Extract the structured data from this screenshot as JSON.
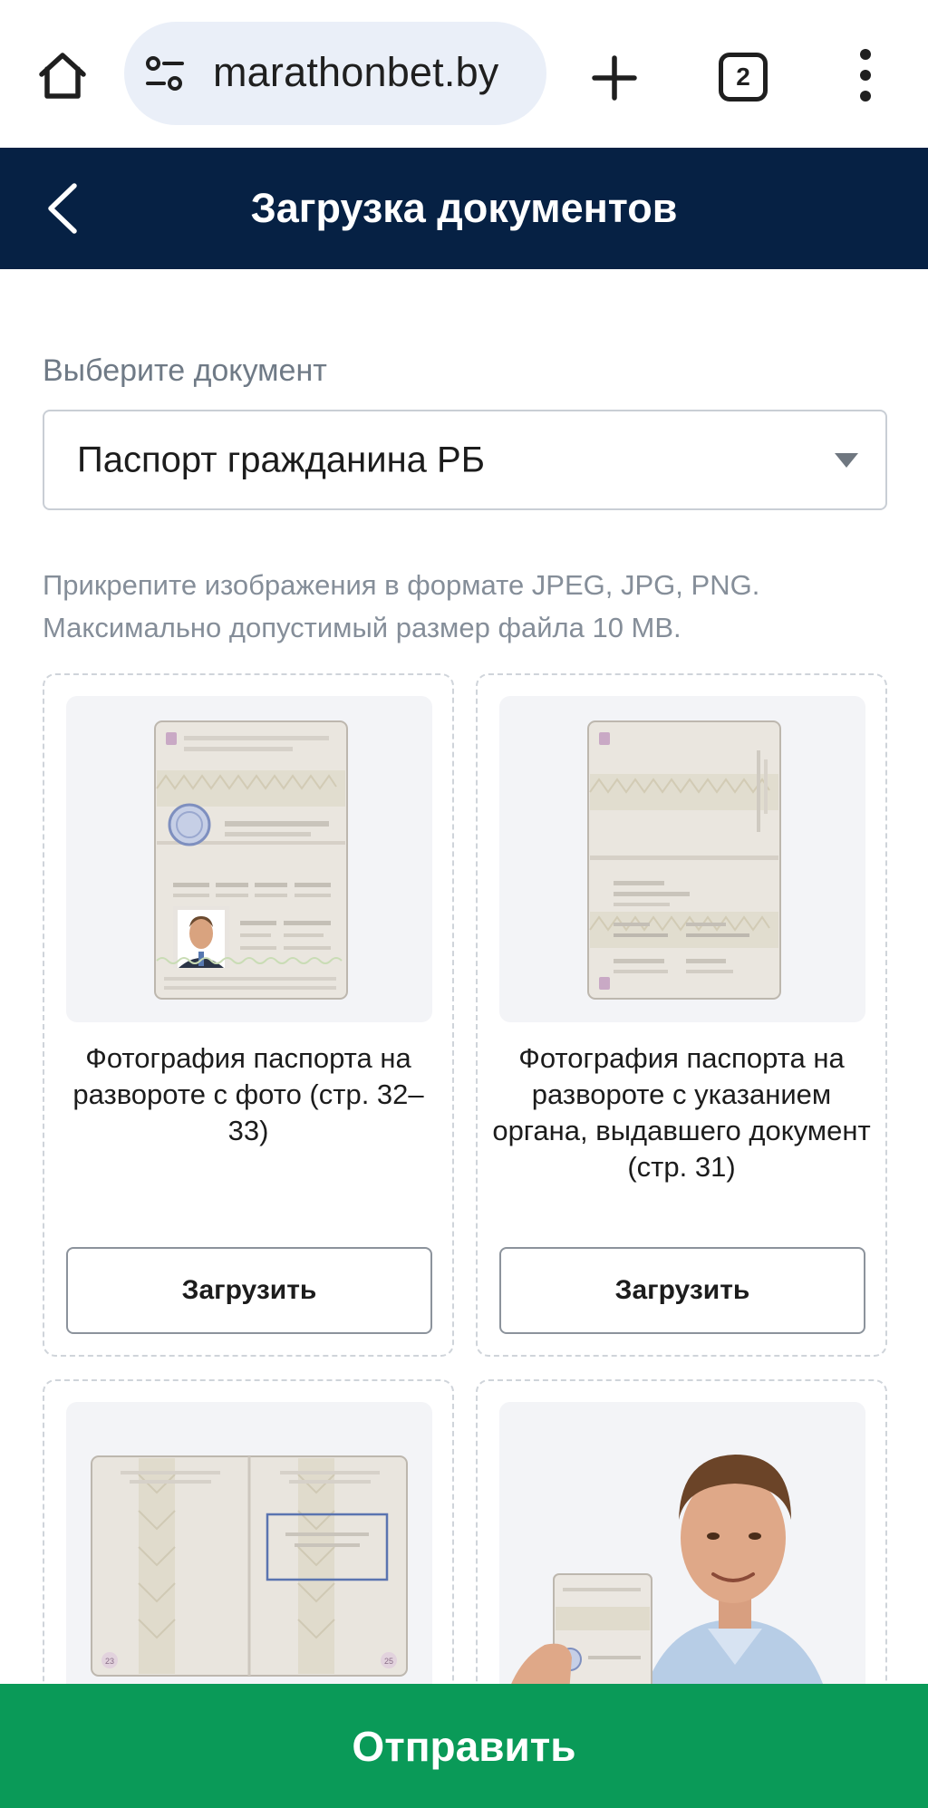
{
  "browser": {
    "url": "marathonbet.by",
    "tab_count": "2",
    "icons": [
      "home-icon",
      "site-settings-icon",
      "plus-icon",
      "tab-switcher-icon",
      "more-vert-icon"
    ]
  },
  "header": {
    "title": "Загрузка документов",
    "back_icon": "chevron-left-icon",
    "background": "#062144"
  },
  "form": {
    "select_label": "Выберите документ",
    "selected_document": "Паспорт гражданина РБ",
    "hint_line1": "Прикрепите изображения в формате JPEG, JPG, PNG.",
    "hint_line2": "Максимально допустимый размер файла 10 MB."
  },
  "cards": [
    {
      "caption": "Фотография паспорта на развороте с фото (стр. 32–33)",
      "button": "Загрузить",
      "image": "passport-photo-page-illustration"
    },
    {
      "caption": "Фотография паспорта на развороте с указанием органа, выдавшего документ (стр. 31)",
      "button": "Загрузить",
      "image": "passport-issuing-authority-page-illustration"
    },
    {
      "image": "passport-spread-pages-illustration",
      "page_left": "23",
      "page_right": "25"
    },
    {
      "image": "selfie-with-passport-photo"
    }
  ],
  "footer": {
    "submit_label": "Отправить",
    "color": "#0a9a58"
  }
}
